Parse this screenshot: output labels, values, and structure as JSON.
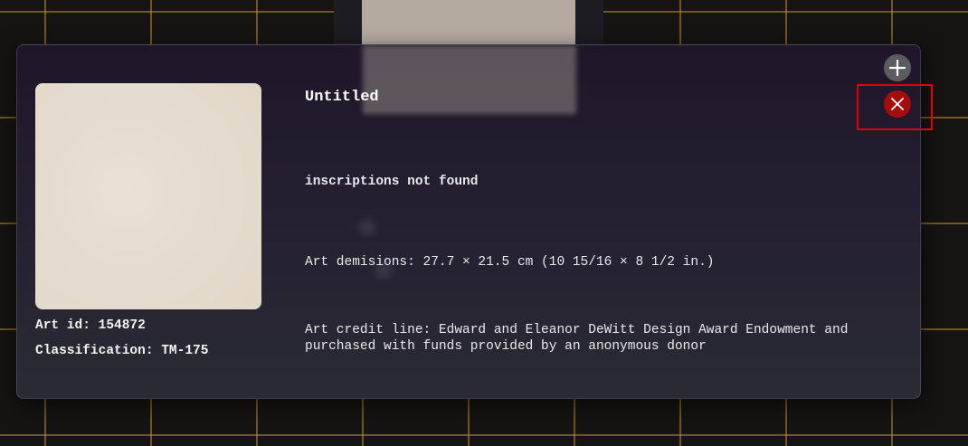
{
  "artwork": {
    "title": "Untitled",
    "art_id_label": "Art id: 154872",
    "classification_label": "Classification: TM-175",
    "inscriptions": "inscriptions not found",
    "dimensions": "Art demisions: 27.7 × 21.5 cm (10 15/16 × 8 1/2 in.)",
    "credit_line": "Art credit line: Edward and Eleanor DeWitt Design Award Endowment and purchased with funds provided by an anonymous donor"
  },
  "controls": {
    "add_icon": "plus-icon",
    "close_icon": "close-icon"
  },
  "colors": {
    "close_button": "#a50d0d",
    "add_button": "#5c5c60",
    "grid_lines": "#c48c28",
    "highlight": "#e00000"
  }
}
